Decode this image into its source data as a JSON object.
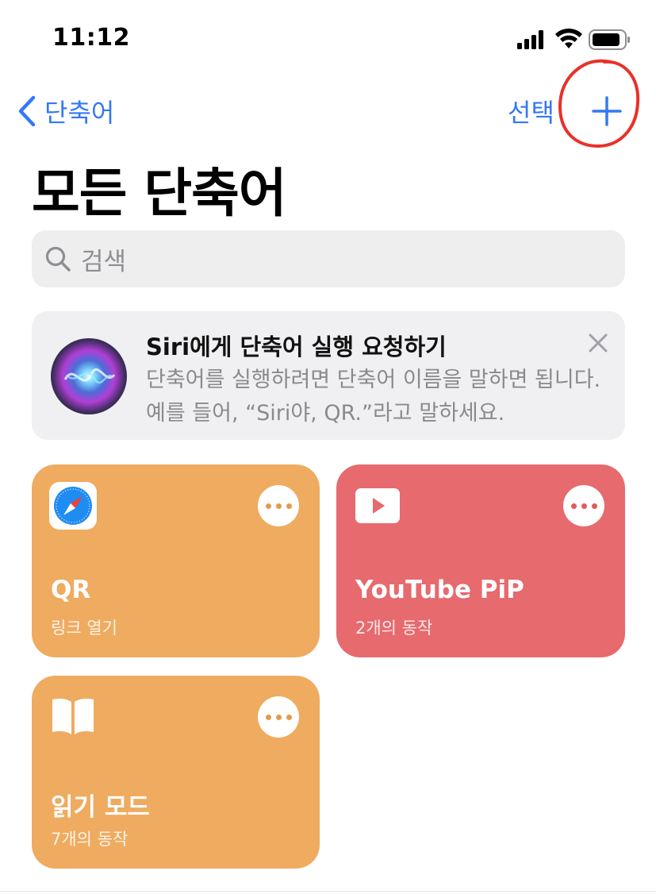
{
  "status_bar": {
    "time": "11:12"
  },
  "nav": {
    "back_label": "단축어",
    "select_label": "선택"
  },
  "page": {
    "title": "모든 단축어"
  },
  "search": {
    "placeholder": "검색"
  },
  "siri_card": {
    "title": "Siri에게 단축어 실행 요청하기",
    "description": "단축어를 실행하려면 단축어 이름을 말하면 됩니다. 예를 들어, “Siri야, QR.”라고 말하세요."
  },
  "shortcuts": [
    {
      "name": "QR",
      "subtitle": "링크 열기",
      "color": "#efab60",
      "icon": "safari-icon"
    },
    {
      "name": "YouTube PiP",
      "subtitle": "2개의 동작",
      "color": "#e66a6e",
      "icon": "play-icon"
    },
    {
      "name": "읽기 모드",
      "subtitle": "7개의 동작",
      "color": "#efab60",
      "icon": "book-icon"
    }
  ],
  "colors": {
    "accent": "#3478f6",
    "annotation": "#e8312a"
  }
}
